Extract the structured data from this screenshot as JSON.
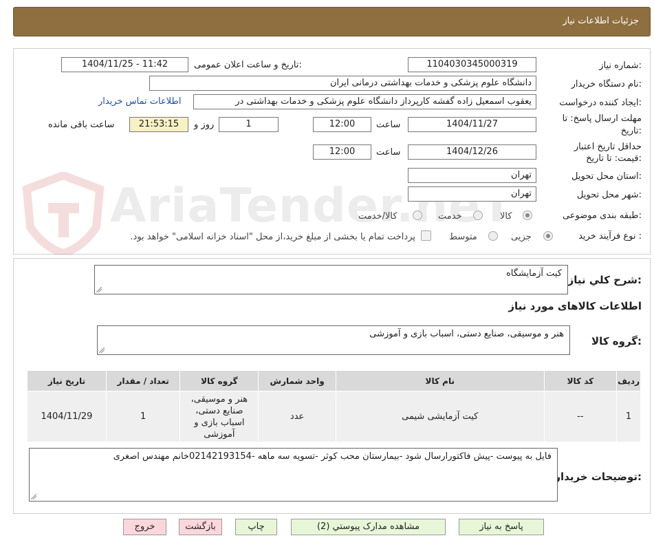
{
  "header": {
    "title": "جزئیات اطلاعات نیاز"
  },
  "form": {
    "need_number_label": "شماره نیاز:",
    "need_number": "1104030345000319",
    "announce_label": "تاریخ و ساعت اعلان عمومی:",
    "announce_value": "1404/11/25 - 11:42",
    "buyer_org_label": "نام دستگاه خریدار:",
    "buyer_org": "دانشگاه علوم پزشکی و خدمات بهداشتی درمانی ایران",
    "requester_label": "ایجاد کننده درخواست:",
    "requester": "یعقوب اسمعیل زاده گفشه کارپرداز دانشگاه علوم پزشکی و خدمات بهداشتی در",
    "contact_link": "اطلاعات تماس خریدار",
    "deadline_label_1": "مهلت ارسال پاسخ: تا",
    "deadline_label_2": "تاریخ:",
    "deadline_date": "1404/11/27",
    "time_label": "ساعت",
    "deadline_time": "12:00",
    "days_value": "1",
    "days_label": "روز و",
    "remaining_time": "21:53:15",
    "remaining_label": "ساعت باقی مانده",
    "validity_label_1": "حداقل تاریخ اعتبار",
    "validity_label_2": "قیمت: تا تاریخ:",
    "validity_date": "1404/12/26",
    "validity_time": "12:00",
    "province_label": "استان محل تحویل:",
    "province": "تهران",
    "city_label": "شهر محل تحویل:",
    "city": "تهران",
    "category_label": "طبقه بندی موضوعی:",
    "category_options": [
      "کالا",
      "خدمت",
      "کالا/خدمت"
    ],
    "process_label": "نوع فرآیند خرید :",
    "process_options": [
      "جزیی",
      "متوسط"
    ],
    "payment_note": "پرداخت تمام یا بخشی از مبلغ خرید،از محل \"اسناد خزانه اسلامی\" خواهد بود."
  },
  "watermark": {
    "text": "AriaTender.neT"
  },
  "description": {
    "label": "شرح کلي نياز:",
    "value": "کیت آزمایشگاه"
  },
  "goods": {
    "section_title": "اطلاعات کالاهای مورد نیاز",
    "group_label": "گروه کالا:",
    "group_value": "هنر و موسیقی، صنایع دستی، اسباب بازی و آموزشی",
    "columns": [
      "ردیف",
      "کد کالا",
      "نام کالا",
      "واحد شمارش",
      "گروه کالا",
      "تعداد / مقدار",
      "تاریخ نیاز"
    ],
    "rows": [
      {
        "row": "1",
        "code": "--",
        "name": "کیت آزمایشی شیمی",
        "unit": "عدد",
        "group": "هنر و موسیقی، صنایع دستی، اسباب بازی و آموزشی",
        "qty": "1",
        "date": "1404/11/29"
      }
    ]
  },
  "buyer_notes": {
    "label": "توضیحات خریدار:",
    "value": "فایل به پیوست -پیش فاکتورارسال شود -بیمارستان محب کوثر -تسویه سه ماهه -02142193154خانم مهندس اصغری"
  },
  "buttons": {
    "reply": "پاسخ به نیاز",
    "attachments": "مشاهده مدارک پیوستي (2)",
    "print": "چاپ",
    "back": "بازگشت",
    "exit": "خروج"
  },
  "colors": {
    "header_bg": "#8f6f3f",
    "button_green": "#e8f6d8",
    "button_pink": "#fbd7dc",
    "remaining_bg": "#f6f2c4",
    "link": "#1a4fb0"
  }
}
